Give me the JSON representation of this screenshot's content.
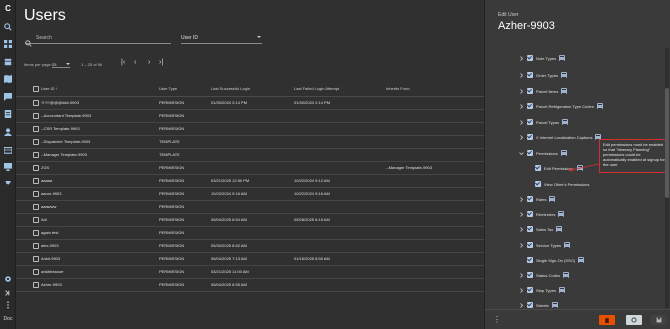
{
  "app": {
    "logo": "C",
    "user_label": "Doc"
  },
  "rail_icons": [
    "search-icon",
    "grid-icon",
    "box-icon",
    "map-icon",
    "chat-icon",
    "list-icon",
    "users-icon",
    "tray-icon",
    "monitor-icon",
    "wrench-icon"
  ],
  "page": {
    "title": "Users"
  },
  "search": {
    "placeholder": "Search"
  },
  "filter": {
    "selected": "User ID"
  },
  "pager": {
    "items_per_page_label": "Items per page:",
    "items_per_page": "25",
    "range": "1 – 25 of 96"
  },
  "table": {
    "headers": [
      "User ID",
      "User Type",
      "Last Successful Login",
      "Last Failed Login Attempt",
      "Inherits From"
    ],
    "rows": [
      [
        "?!?!?@@@###-9903",
        "PERMISSION",
        "01/30/2024 2:14 PM",
        "01/30/2024 2:14 PM",
        ""
      ],
      [
        "--Accountant Template-9903",
        "PERMISSION",
        "",
        "",
        ""
      ],
      [
        "--CSR Template-9903",
        "PERMISSION",
        "",
        "",
        ""
      ],
      [
        "--Dispatcher Template-9903",
        "TEMPLATE",
        "",
        "",
        ""
      ],
      [
        "--Manager Template-9903",
        "TEMPLATE",
        "",
        "",
        ""
      ],
      [
        "ZGS",
        "PERMISSION",
        "",
        "",
        "--Manager Template-9903"
      ],
      [
        "aaaaa",
        "PERMISSION",
        "03/21/2025 12:00 PM",
        "10/22/2024 9:12 AM",
        ""
      ],
      [
        "aaron-9903",
        "PERMISSION",
        "10/22/2024 9:16 AM",
        "10/22/2024 9:16 AM",
        ""
      ],
      [
        "aaawww",
        "PERMISSION",
        "",
        "",
        ""
      ],
      [
        "Adi",
        "PERMISSION",
        "06/04/2025 6:54 AM",
        "05/28/2025 6:15 AM",
        ""
      ],
      [
        "again test",
        "PERMISSION",
        "",
        "",
        ""
      ],
      [
        "alex-9903",
        "PERMISSION",
        "05/30/2025 8:52 AM",
        "",
        ""
      ],
      [
        "Ankit-9903",
        "PERMISSION",
        "06/04/2025 7:13 AM",
        "01/16/2025 8:50 AM",
        ""
      ],
      [
        "ankittestuser",
        "PERMISSION",
        "03/21/2025 11:00 AM",
        "",
        ""
      ],
      [
        "Azher-9903",
        "PERMISSION",
        "06/04/2025 6:55 AM",
        "",
        ""
      ]
    ]
  },
  "drawer": {
    "label": "Edit User",
    "name": "Azher-9903",
    "permissions": [
      {
        "label": "Note Types",
        "expandable": true,
        "info": true
      },
      {
        "label": "Order Types",
        "expandable": true,
        "info": true
      },
      {
        "label": "Parcel Items",
        "expandable": true,
        "info": true
      },
      {
        "label": "Parcel Refrigeration Type Codes",
        "expandable": true,
        "info": true
      },
      {
        "label": "Parcel Types",
        "expandable": true,
        "info": true
      },
      {
        "label": "X Internet Localization Captions",
        "expandable": true,
        "info": true
      },
      {
        "label": "Permissions",
        "expandable": true,
        "expanded": true,
        "info": true
      },
      {
        "label": "Edit Permissions",
        "expandable": false,
        "info": true,
        "child": true
      },
      {
        "label": "View Other's Permissions",
        "expandable": false,
        "info": false,
        "child": true
      },
      {
        "label": "Rates",
        "expandable": true,
        "info": true
      },
      {
        "label": "Reminders",
        "expandable": true,
        "info": true
      },
      {
        "label": "Sales Tax",
        "expandable": true,
        "info": true
      },
      {
        "label": "Service Types",
        "expandable": true,
        "info": true
      },
      {
        "label": "Single Sign-On (SSO)",
        "expandable": false,
        "info": true
      },
      {
        "label": "Status Codes",
        "expandable": true,
        "info": true
      },
      {
        "label": "Stop Types",
        "expandable": true,
        "info": true
      },
      {
        "label": "Streets",
        "expandable": true,
        "info": true
      }
    ],
    "tooltip": "Edit permissions must be enabled so that \"Itinerary Planning\" permissions could be automatically enabled at signup for the user",
    "footer": {
      "delete_color": "#e65100",
      "refresh_color": "#cfd8dc",
      "save_color": "#424242"
    }
  }
}
